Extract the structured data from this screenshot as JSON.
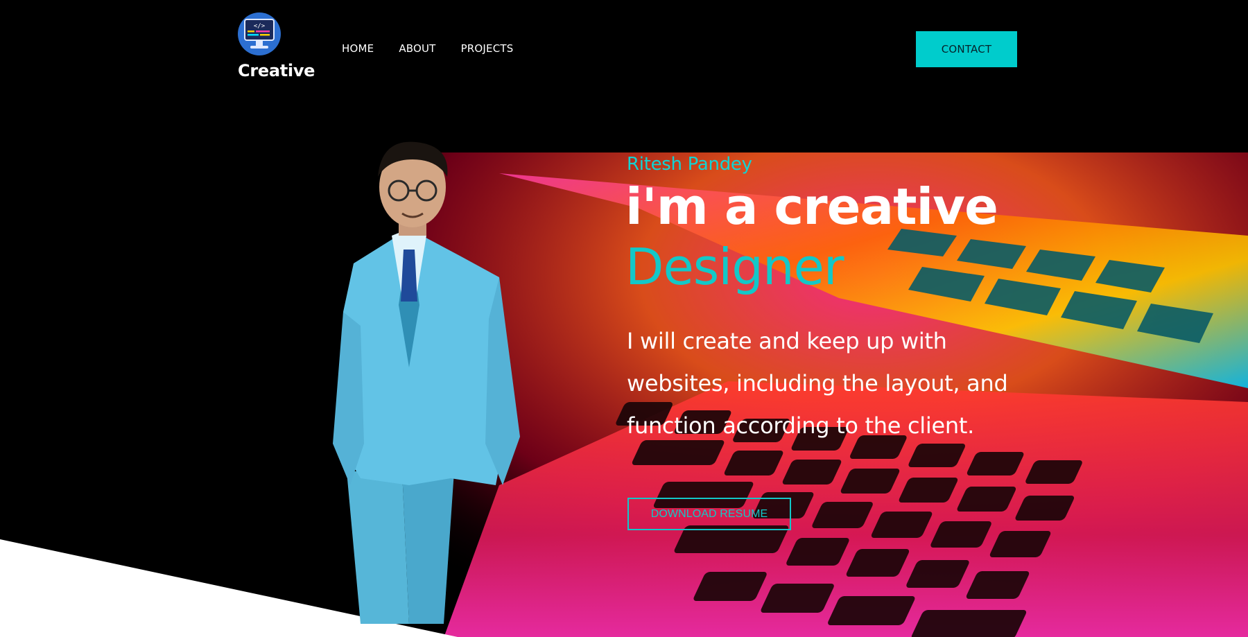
{
  "brand": {
    "name": "Creative",
    "logo": "monitor-code-icon"
  },
  "nav": {
    "items": [
      "HOME",
      "ABOUT",
      "PROJECTS"
    ],
    "contact_label": "CONTACT"
  },
  "hero": {
    "name": "Ritesh Pandey",
    "headline": "i'm a creative",
    "role": "Designer",
    "description": "I will create and keep up with websites, including the layout, and function according to the client.",
    "resume_label": "DOWNLOAD RESUME"
  },
  "colors": {
    "accent": "#00cccc",
    "background": "#000000",
    "text": "#ffffff"
  }
}
